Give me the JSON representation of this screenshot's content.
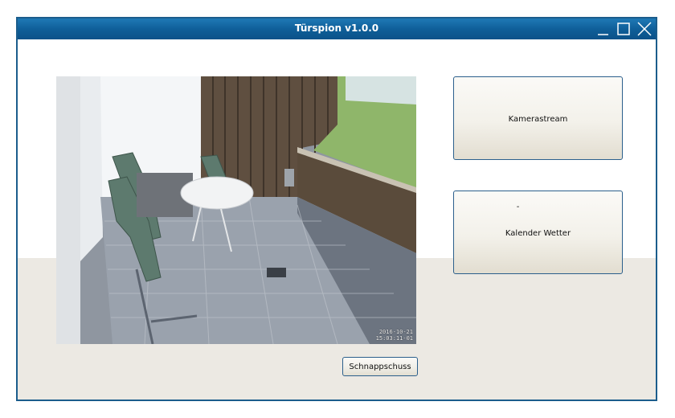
{
  "window": {
    "title": "Türspion v1.0.0",
    "controls": [
      "minimize-icon",
      "maximize-icon",
      "close-icon"
    ],
    "colors": {
      "titlebar": "#0e5d97",
      "border": "#1b5d8c",
      "background": "#ece9e3"
    }
  },
  "camera": {
    "timestamp_date": "2016-10-21",
    "timestamp_time": "15:03:11-01"
  },
  "buttons": {
    "kamerastream": "Kamerastream",
    "kalender_top": "-",
    "kalender_wetter": "Kalender  Wetter",
    "snapshot": "Schnappschuss"
  }
}
